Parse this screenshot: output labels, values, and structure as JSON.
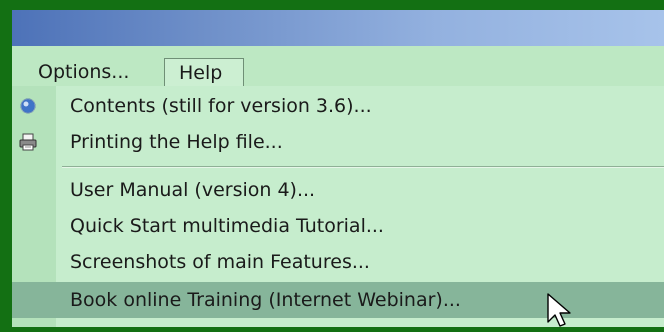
{
  "menubar": {
    "options_label": "Options...",
    "help_label": "Help"
  },
  "help_menu": {
    "items": [
      {
        "label": "Contents (still for version 3.6)...",
        "icon": "help-globe-icon"
      },
      {
        "label": "Printing the Help file...",
        "icon": "printer-icon"
      },
      {
        "label": "User Manual (version 4)..."
      },
      {
        "label": "Quick Start multimedia Tutorial..."
      },
      {
        "label": "Screenshots of main Features..."
      },
      {
        "label": "Book online Training (Internet Webinar)...",
        "highlighted": true
      }
    ]
  },
  "colors": {
    "desktop_green": "#137013",
    "menu_background": "#c6edcd",
    "highlight": "#86b59a",
    "titlebar_blue": "#6f90c9"
  }
}
